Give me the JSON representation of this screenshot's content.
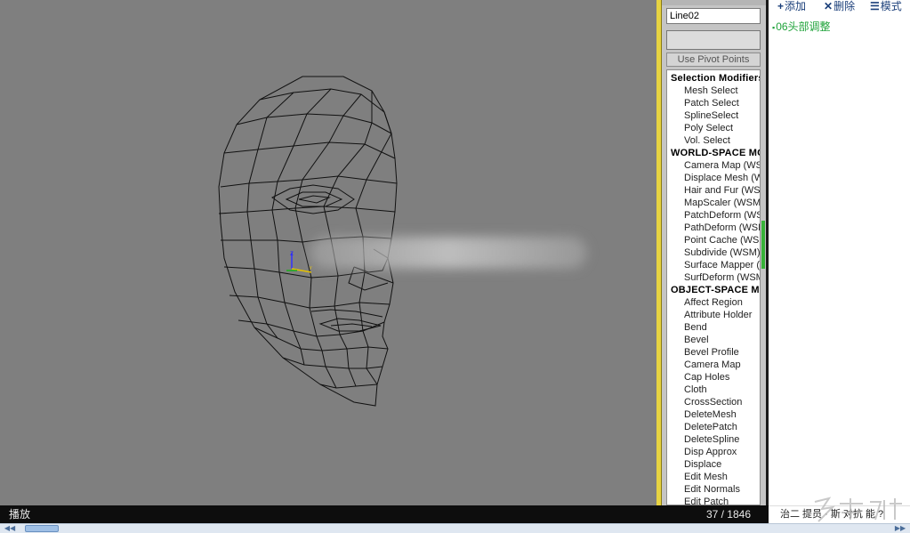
{
  "command_panel": {
    "object_name": "Line02",
    "pivot_button": "Use Pivot Points",
    "modifier_list": [
      {
        "kind": "group",
        "label": "Selection Modifiers"
      },
      {
        "kind": "item",
        "label": "Mesh Select"
      },
      {
        "kind": "item",
        "label": "Patch Select"
      },
      {
        "kind": "item",
        "label": "SplineSelect"
      },
      {
        "kind": "item",
        "label": "Poly Select"
      },
      {
        "kind": "item",
        "label": "Vol. Select"
      },
      {
        "kind": "group",
        "label": "WORLD-SPACE MODIFIERS"
      },
      {
        "kind": "item",
        "label": "Camera Map (WSM)"
      },
      {
        "kind": "item",
        "label": "Displace Mesh (WSM)"
      },
      {
        "kind": "item",
        "label": "Hair and Fur (WSM)"
      },
      {
        "kind": "item",
        "label": "MapScaler (WSM)"
      },
      {
        "kind": "item",
        "label": "PatchDeform (WSM)"
      },
      {
        "kind": "item",
        "label": "PathDeform (WSM)"
      },
      {
        "kind": "item",
        "label": "Point Cache (WSM)"
      },
      {
        "kind": "item",
        "label": "Subdivide (WSM)"
      },
      {
        "kind": "item",
        "label": "Surface Mapper (WSM)"
      },
      {
        "kind": "item",
        "label": "SurfDeform (WSM)"
      },
      {
        "kind": "group",
        "label": "OBJECT-SPACE MODIFIERS"
      },
      {
        "kind": "item",
        "label": "Affect Region"
      },
      {
        "kind": "item",
        "label": "Attribute Holder"
      },
      {
        "kind": "item",
        "label": "Bend"
      },
      {
        "kind": "item",
        "label": "Bevel"
      },
      {
        "kind": "item",
        "label": "Bevel Profile"
      },
      {
        "kind": "item",
        "label": "Camera Map"
      },
      {
        "kind": "item",
        "label": "Cap Holes"
      },
      {
        "kind": "item",
        "label": "Cloth"
      },
      {
        "kind": "item",
        "label": "CrossSection"
      },
      {
        "kind": "item",
        "label": "DeleteMesh"
      },
      {
        "kind": "item",
        "label": "DeletePatch"
      },
      {
        "kind": "item",
        "label": "DeleteSpline"
      },
      {
        "kind": "item",
        "label": "Disp Approx"
      },
      {
        "kind": "item",
        "label": "Displace"
      },
      {
        "kind": "item",
        "label": "Edit Mesh"
      },
      {
        "kind": "item",
        "label": "Edit Normals"
      },
      {
        "kind": "item",
        "label": "Edit Patch"
      }
    ]
  },
  "viewport": {
    "gizmo_axis_label": "z"
  },
  "right_panel": {
    "toolbar": {
      "add_icon": "+",
      "add_label": "添加",
      "delete_icon": "✕",
      "delete_label": "删除",
      "mode_icon": "☰",
      "mode_label": "模式"
    },
    "chapter_items": [
      "06头部调整"
    ],
    "footer_text": "治二 提员 · 斯 对抗 能 ?"
  },
  "status_bar": {
    "play_label": "播放",
    "page_counter": "37 / 1846"
  },
  "colors": {
    "viewport_bg": "#7f7f7f",
    "accent_yellow": "#e7d342",
    "chapter_green": "#1fa33a",
    "toolbar_blue": "#1b3f7a"
  }
}
